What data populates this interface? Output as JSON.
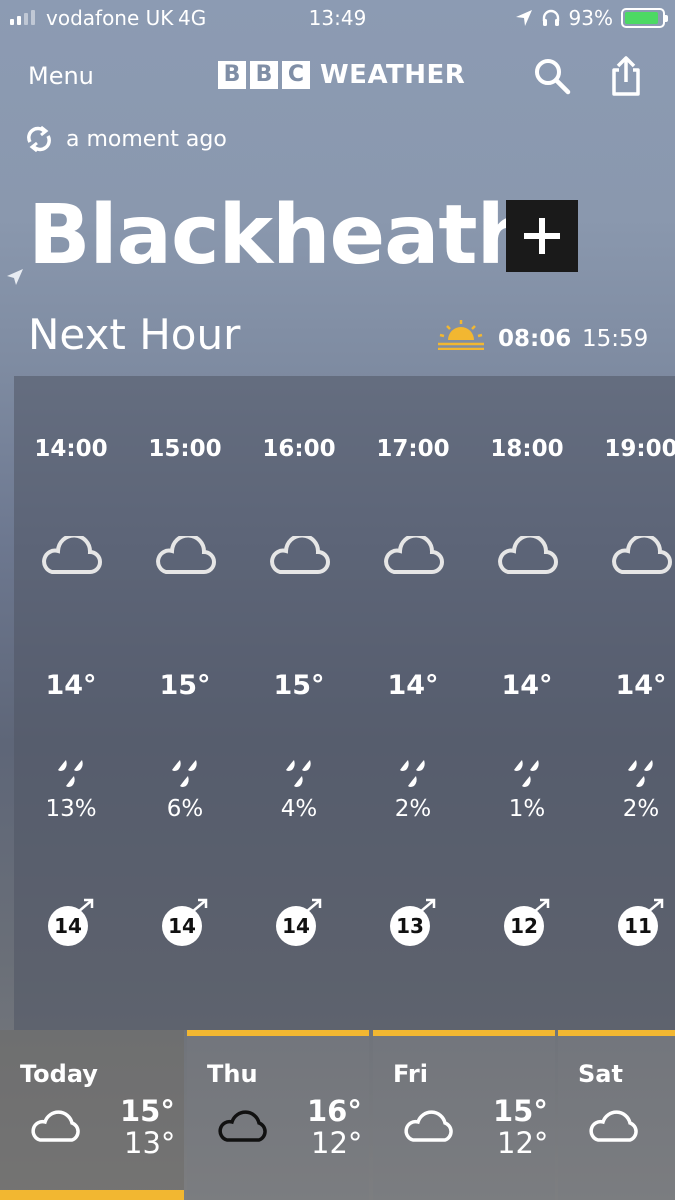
{
  "status_bar": {
    "carrier": "vodafone UK",
    "network": "4G",
    "time": "13:49",
    "battery": "93%",
    "battery_fraction": 0.93,
    "icons": [
      "signal-icon",
      "location-arrow-icon",
      "headphones-icon",
      "battery-charging-icon"
    ]
  },
  "header": {
    "menu_label": "Menu",
    "logo_letters": [
      "B",
      "B",
      "C"
    ],
    "logo_word": "WEATHER",
    "icons": [
      "search-icon",
      "share-icon"
    ]
  },
  "refresh": {
    "label": "a moment ago",
    "icon": "refresh-icon"
  },
  "location": {
    "name": "Blackheath",
    "add_icon": "plus-icon",
    "current_location_icon": "location-arrow-icon"
  },
  "next_hour": {
    "label": "Next Hour",
    "sunrise": "08:06",
    "sunset": "15:59",
    "sun_icon": "sunrise-icon",
    "sun_color": "#f2b731"
  },
  "hourly": [
    {
      "time": "14:00",
      "icon": "cloud-icon",
      "temp": "14°",
      "rain": "13%",
      "wind": "14"
    },
    {
      "time": "15:00",
      "icon": "cloud-icon",
      "temp": "15°",
      "rain": "6%",
      "wind": "14"
    },
    {
      "time": "16:00",
      "icon": "cloud-icon",
      "temp": "15°",
      "rain": "4%",
      "wind": "14"
    },
    {
      "time": "17:00",
      "icon": "cloud-icon",
      "temp": "14°",
      "rain": "2%",
      "wind": "13"
    },
    {
      "time": "18:00",
      "icon": "cloud-icon",
      "temp": "14°",
      "rain": "1%",
      "wind": "12"
    },
    {
      "time": "19:00",
      "icon": "cloud-icon",
      "temp": "14°",
      "rain": "2%",
      "wind": "11"
    }
  ],
  "daily": [
    {
      "day": "Today",
      "icon": "cloud-icon",
      "high": "15°",
      "low": "13°"
    },
    {
      "day": "Thu",
      "icon": "cloud-icon",
      "high": "16°",
      "low": "12°"
    },
    {
      "day": "Fri",
      "icon": "cloud-icon",
      "high": "15°",
      "low": "12°"
    },
    {
      "day": "Sat",
      "icon": "cloud-icon",
      "high": "",
      "low": ""
    }
  ],
  "colors": {
    "accent": "#f2b731",
    "add_button": "#1a1a1a",
    "battery_charge": "#4cd964"
  }
}
